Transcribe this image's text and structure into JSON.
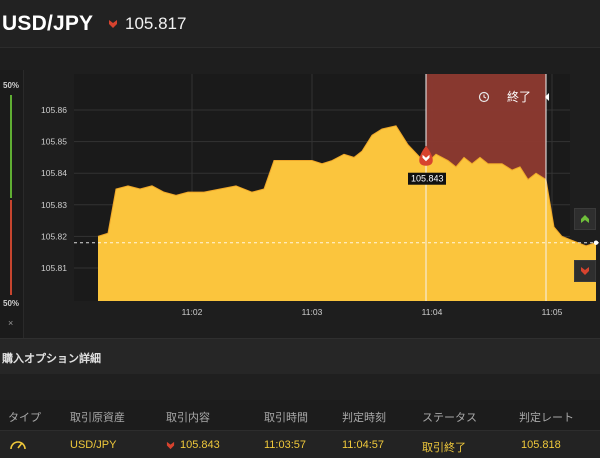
{
  "header": {
    "pair": "USD/JPY",
    "rate": "105.817",
    "direction_icon": "down-arrow-icon"
  },
  "chart": {
    "meter_top": "50%",
    "meter_bottom": "50%",
    "meter_close": "×",
    "expired_label": "終了",
    "entry_label": "105.843",
    "history_icon": "history-icon",
    "colors": {
      "area": "#fbc53d",
      "expired_zone": "#8e3a30",
      "up": "#6fbf3a",
      "down": "#d7432e"
    }
  },
  "chart_data": {
    "type": "area",
    "y_ticks": [
      "105.86",
      "105.85",
      "105.84",
      "105.83",
      "105.82",
      "105.81"
    ],
    "x_ticks": [
      "11:02",
      "11:03",
      "11:04",
      "11:05"
    ],
    "ylim": [
      105.806,
      105.884
    ],
    "time_range": [
      "11:01:13",
      "11:05:09"
    ],
    "entry_time": "11:03:57",
    "expiry_time": "11:04:57",
    "entry_rate": 105.843,
    "current_rate": 105.818,
    "points": [
      [
        "11:01:13",
        105.82
      ],
      [
        "11:01:18",
        105.821
      ],
      [
        "11:01:22",
        105.835
      ],
      [
        "11:01:28",
        105.836
      ],
      [
        "11:01:34",
        105.835
      ],
      [
        "11:01:40",
        105.836
      ],
      [
        "11:01:46",
        105.834
      ],
      [
        "11:01:52",
        105.833
      ],
      [
        "11:01:58",
        105.834
      ],
      [
        "11:02:06",
        105.834
      ],
      [
        "11:02:14",
        105.835
      ],
      [
        "11:02:22",
        105.836
      ],
      [
        "11:02:30",
        105.834
      ],
      [
        "11:02:36",
        105.835
      ],
      [
        "11:02:41",
        105.844
      ],
      [
        "11:02:50",
        105.844
      ],
      [
        "11:03:00",
        105.844
      ],
      [
        "11:03:05",
        105.843
      ],
      [
        "11:03:10",
        105.844
      ],
      [
        "11:03:16",
        105.846
      ],
      [
        "11:03:21",
        105.845
      ],
      [
        "11:03:25",
        105.847
      ],
      [
        "11:03:30",
        105.852
      ],
      [
        "11:03:35",
        105.854
      ],
      [
        "11:03:42",
        105.855
      ],
      [
        "11:03:48",
        105.849
      ],
      [
        "11:03:57",
        105.843
      ],
      [
        "11:04:02",
        105.846
      ],
      [
        "11:04:08",
        105.844
      ],
      [
        "11:04:12",
        105.842
      ],
      [
        "11:04:16",
        105.845
      ],
      [
        "11:04:20",
        105.843
      ],
      [
        "11:04:24",
        105.845
      ],
      [
        "11:04:28",
        105.843
      ],
      [
        "11:04:35",
        105.843
      ],
      [
        "11:04:40",
        105.841
      ],
      [
        "11:04:44",
        105.842
      ],
      [
        "11:04:48",
        105.838
      ],
      [
        "11:04:52",
        105.84
      ],
      [
        "11:04:57",
        105.838
      ],
      [
        "11:05:01",
        105.823
      ],
      [
        "11:05:05",
        105.82
      ],
      [
        "11:05:09",
        105.819
      ],
      [
        "11:05:13",
        105.818
      ],
      [
        "11:05:17",
        105.817
      ],
      [
        "11:05:22",
        105.818
      ]
    ]
  },
  "section": {
    "title": "購入オプション詳細"
  },
  "table": {
    "headers": [
      "タイプ",
      "取引原資産",
      "取引内容",
      "取引時間",
      "判定時刻",
      "ステータス",
      "判定レート"
    ],
    "row": {
      "type_icon": "gauge-icon",
      "asset": "USD/JPY",
      "rate": "105.843",
      "trade_time": "11:03:57",
      "judge_time": "11:04:57",
      "status": "取引終了",
      "judge_rate": "105.818"
    }
  }
}
